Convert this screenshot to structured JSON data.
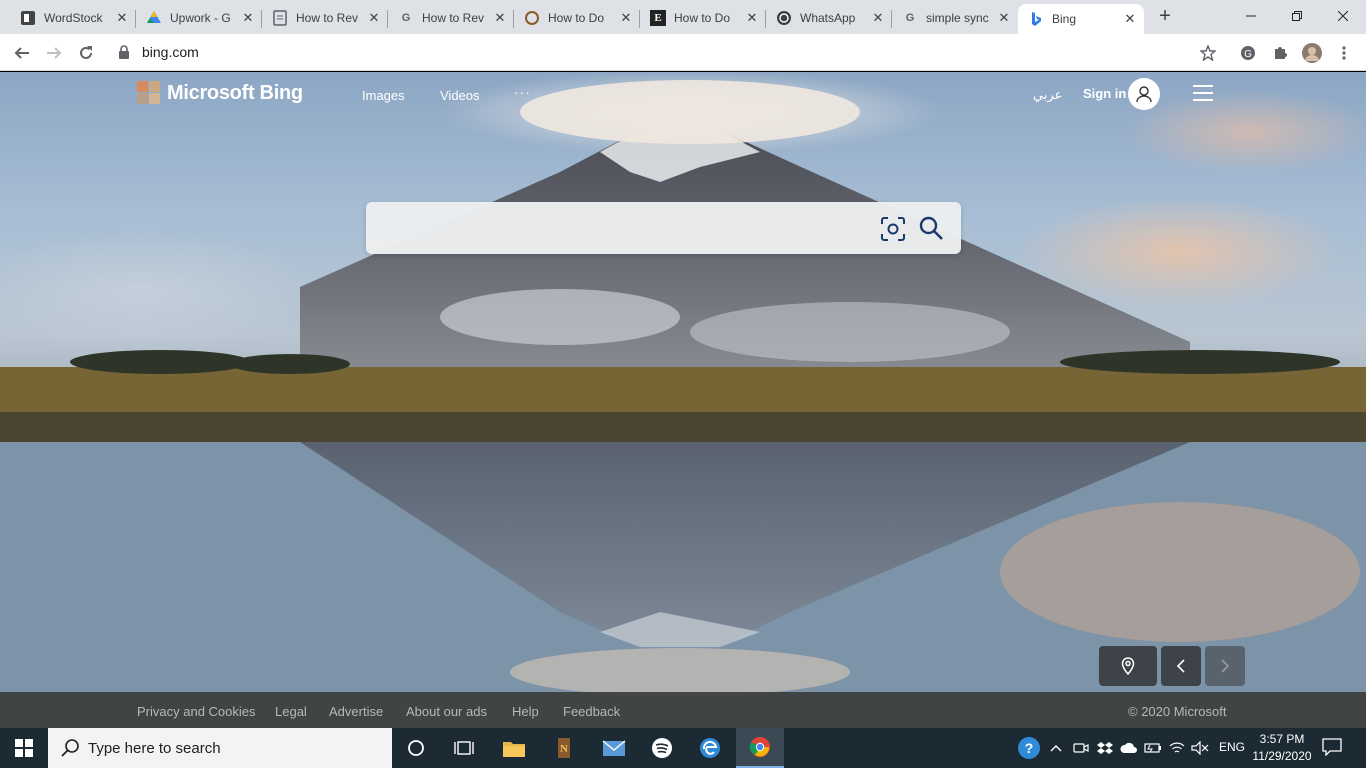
{
  "browser": {
    "tabs": [
      {
        "title": "WordStock",
        "favicon": "wordstock-icon",
        "active": false
      },
      {
        "title": "Upwork - G",
        "favicon": "drive-icon",
        "active": false
      },
      {
        "title": "How to Rev",
        "favicon": "docs-icon",
        "active": false
      },
      {
        "title": "How to Rev",
        "favicon": "google-icon",
        "active": false
      },
      {
        "title": "How to Do",
        "favicon": "circle-icon",
        "active": false
      },
      {
        "title": "How to Do",
        "favicon": "e-icon",
        "active": false
      },
      {
        "title": "WhatsApp",
        "favicon": "whatsapp-icon",
        "active": false
      },
      {
        "title": "simple sync",
        "favicon": "google-icon",
        "active": false
      },
      {
        "title": "Bing",
        "favicon": "bing-icon",
        "active": true
      }
    ],
    "new_tab_glyph": "+",
    "address": "bing.com"
  },
  "bing": {
    "logo_text": "Microsoft Bing",
    "nav": {
      "images": "Images",
      "videos": "Videos",
      "more": "···"
    },
    "language_link": "عربي",
    "sign_in": "Sign in",
    "search": {
      "value": "",
      "placeholder": ""
    },
    "footer": {
      "links": [
        "Privacy and Cookies",
        "Legal",
        "Advertise",
        "About our ads",
        "Help",
        "Feedback"
      ],
      "copyright": "© 2020 Microsoft"
    }
  },
  "taskbar": {
    "search_placeholder": "Type here to search",
    "language": "ENG",
    "time": "3:57 PM",
    "date": "11/29/2020"
  },
  "colors": {
    "tabstrip": "#dee1e6",
    "taskbar": "#1c2a33",
    "bing_logo_orange": "#f25022"
  }
}
